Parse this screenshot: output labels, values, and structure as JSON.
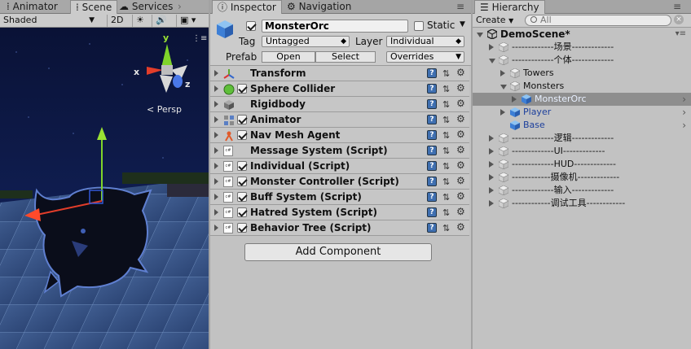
{
  "scene_panel": {
    "tabs": [
      "Animator",
      "Scene",
      "Services"
    ],
    "active_tab": "Scene",
    "shading_mode": "Shaded",
    "mode_2d_label": "2D",
    "view_label": "Persp",
    "gizmo_axes": {
      "x": "x",
      "y": "y",
      "z": "z"
    }
  },
  "inspector": {
    "tab_label": "Inspector",
    "nav_tab_label": "Navigation",
    "object_name": "MonsterOrc",
    "static_label": "Static",
    "static_checked": false,
    "active_checked": true,
    "tag_label": "Tag",
    "tag_value": "Untagged",
    "layer_label": "Layer",
    "layer_value": "Individual",
    "prefab_label": "Prefab",
    "open_label": "Open",
    "select_label": "Select",
    "overrides_label": "Overrides",
    "add_component_label": "Add Component",
    "components": [
      {
        "name": "Transform",
        "has_checkbox": false,
        "icon": "transform-icon"
      },
      {
        "name": "Sphere Collider",
        "has_checkbox": true,
        "icon": "sphere-collider-icon"
      },
      {
        "name": "Rigidbody",
        "has_checkbox": false,
        "icon": "rigidbody-icon"
      },
      {
        "name": "Animator",
        "has_checkbox": true,
        "icon": "animator-icon"
      },
      {
        "name": "Nav Mesh Agent",
        "has_checkbox": true,
        "icon": "nav-mesh-agent-icon"
      },
      {
        "name": "Message System (Script)",
        "has_checkbox": false,
        "icon": "script-icon"
      },
      {
        "name": "Individual (Script)",
        "has_checkbox": true,
        "icon": "script-icon"
      },
      {
        "name": "Monster Controller (Script)",
        "has_checkbox": true,
        "icon": "script-icon"
      },
      {
        "name": "Buff System (Script)",
        "has_checkbox": true,
        "icon": "script-icon"
      },
      {
        "name": "Hatred System (Script)",
        "has_checkbox": true,
        "icon": "script-icon"
      },
      {
        "name": "Behavior Tree (Script)",
        "has_checkbox": true,
        "icon": "script-icon"
      }
    ]
  },
  "hierarchy": {
    "tab_label": "Hierarchy",
    "create_label": "Create",
    "search_placeholder": "All",
    "scene_name": "DemoScene*",
    "items": [
      {
        "label": "-------------场景-------------",
        "depth": 1,
        "fold": "closed",
        "type": "object",
        "chevron": false
      },
      {
        "label": "-------------个体-------------",
        "depth": 1,
        "fold": "open",
        "type": "object",
        "chevron": false
      },
      {
        "label": "Towers",
        "depth": 2,
        "fold": "closed",
        "type": "object",
        "chevron": false
      },
      {
        "label": "Monsters",
        "depth": 2,
        "fold": "open",
        "type": "object",
        "chevron": false
      },
      {
        "label": "MonsterOrc",
        "depth": 3,
        "fold": "closed",
        "type": "prefab",
        "chevron": true,
        "selected": true
      },
      {
        "label": "Player",
        "depth": 2,
        "fold": "closed",
        "type": "prefab",
        "chevron": true
      },
      {
        "label": "Base",
        "depth": 2,
        "fold": "none",
        "type": "prefab",
        "chevron": true
      },
      {
        "label": "-------------逻辑-------------",
        "depth": 1,
        "fold": "closed",
        "type": "object",
        "chevron": false
      },
      {
        "label": "-------------UI-------------",
        "depth": 1,
        "fold": "closed",
        "type": "object",
        "chevron": false
      },
      {
        "label": "-------------HUD-------------",
        "depth": 1,
        "fold": "closed",
        "type": "object",
        "chevron": false
      },
      {
        "label": "------------摄像机-------------",
        "depth": 1,
        "fold": "closed",
        "type": "object",
        "chevron": false
      },
      {
        "label": "-------------输入-------------",
        "depth": 1,
        "fold": "closed",
        "type": "object",
        "chevron": false
      },
      {
        "label": "------------调试工具------------",
        "depth": 1,
        "fold": "closed",
        "type": "object",
        "chevron": false
      }
    ]
  },
  "colors": {
    "panel_bg": "#c2c2c2",
    "selected_row": "#8e8e8e",
    "prefab_text": "#1c3f9c",
    "sky": "#0e1a4a"
  }
}
